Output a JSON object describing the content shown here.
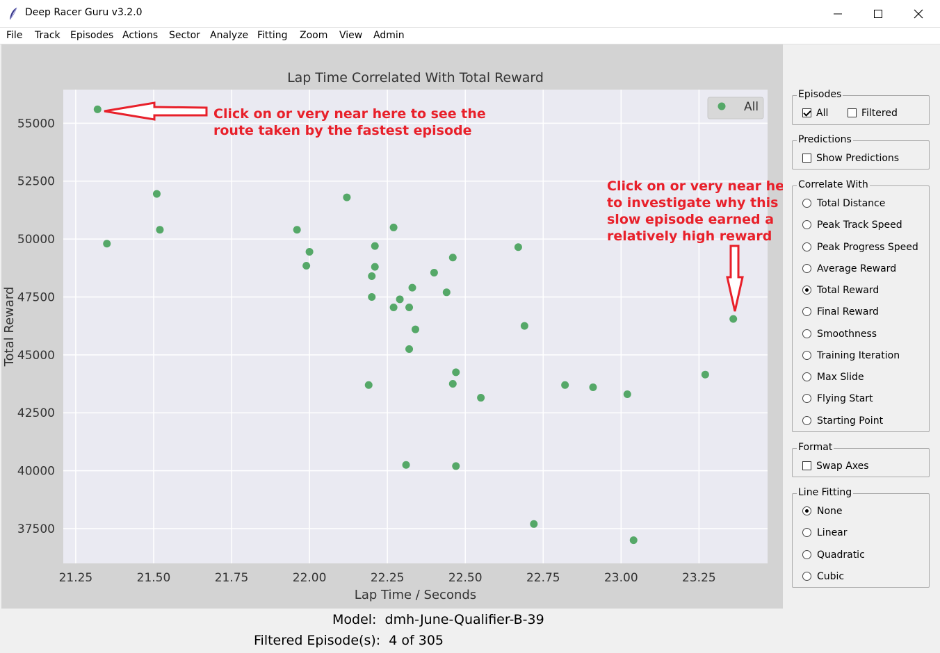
{
  "window": {
    "title": "Deep Racer Guru v3.2.0"
  },
  "menu": [
    "File",
    "Track",
    "Episodes",
    "Actions",
    "Sector",
    "Analyze",
    "Fitting",
    "Zoom",
    "View",
    "Admin"
  ],
  "status": {
    "model_label": "Model:",
    "model_value": "dmh-June-Qualifier-B-39",
    "filtered_label": "Filtered Episode(s):",
    "filtered_value": "4 of 305"
  },
  "panel": {
    "episodes": {
      "legend": "Episodes",
      "options": [
        {
          "label": "All",
          "checked": true
        },
        {
          "label": "Filtered",
          "checked": false
        }
      ]
    },
    "predictions": {
      "legend": "Predictions",
      "options": [
        {
          "label": "Show Predictions",
          "checked": false
        }
      ]
    },
    "correlate": {
      "legend": "Correlate With",
      "options": [
        {
          "label": "Total Distance",
          "checked": false
        },
        {
          "label": "Peak Track Speed",
          "checked": false
        },
        {
          "label": "Peak Progress Speed",
          "checked": false
        },
        {
          "label": "Average Reward",
          "checked": false
        },
        {
          "label": "Total Reward",
          "checked": true
        },
        {
          "label": "Final Reward",
          "checked": false
        },
        {
          "label": "Smoothness",
          "checked": false
        },
        {
          "label": "Training Iteration",
          "checked": false
        },
        {
          "label": "Max Slide",
          "checked": false
        },
        {
          "label": "Flying Start",
          "checked": false
        },
        {
          "label": "Starting Point",
          "checked": false
        }
      ]
    },
    "format": {
      "legend": "Format",
      "options": [
        {
          "label": "Swap Axes",
          "checked": false
        }
      ]
    },
    "line_fitting": {
      "legend": "Line Fitting",
      "options": [
        {
          "label": "None",
          "checked": true
        },
        {
          "label": "Linear",
          "checked": false
        },
        {
          "label": "Quadratic",
          "checked": false
        },
        {
          "label": "Cubic",
          "checked": false
        }
      ]
    }
  },
  "annotations": {
    "fastest": [
      "Click on or very near here to see the",
      "route taken by the fastest episode"
    ],
    "slow": [
      "Click on or very near here",
      "to investigate why this",
      "slow episode earned a",
      "relatively high reward"
    ],
    "color": "#e8202a"
  },
  "chart_data": {
    "type": "scatter",
    "title": "Lap Time Correlated With Total Reward",
    "xlabel": "Lap Time / Seconds",
    "ylabel": "Total Reward",
    "xlim": [
      21.21,
      23.47
    ],
    "ylim": [
      36000,
      56450
    ],
    "xticks": [
      "21.25",
      "21.50",
      "21.75",
      "22.00",
      "22.25",
      "22.50",
      "22.75",
      "23.00",
      "23.25"
    ],
    "yticks": [
      "37500",
      "40000",
      "42500",
      "45000",
      "47500",
      "50000",
      "52500",
      "55000"
    ],
    "grid": true,
    "legend": {
      "label": "All",
      "placement": "top-right"
    },
    "marker_color": "#55a868",
    "plot_bg": "#eaeaf2",
    "series": [
      {
        "name": "All",
        "points": [
          [
            21.32,
            55600
          ],
          [
            21.35,
            49800
          ],
          [
            21.51,
            51950
          ],
          [
            21.52,
            50400
          ],
          [
            21.96,
            50400
          ],
          [
            21.99,
            48850
          ],
          [
            22.0,
            49450
          ],
          [
            22.12,
            51800
          ],
          [
            22.19,
            43700
          ],
          [
            22.2,
            47500
          ],
          [
            22.2,
            48400
          ],
          [
            22.21,
            48800
          ],
          [
            22.21,
            49700
          ],
          [
            22.27,
            47050
          ],
          [
            22.27,
            50500
          ],
          [
            22.29,
            47400
          ],
          [
            22.31,
            40250
          ],
          [
            22.32,
            45250
          ],
          [
            22.32,
            47050
          ],
          [
            22.33,
            47900
          ],
          [
            22.34,
            46100
          ],
          [
            22.4,
            48550
          ],
          [
            22.44,
            47700
          ],
          [
            22.46,
            49200
          ],
          [
            22.46,
            43750
          ],
          [
            22.47,
            44250
          ],
          [
            22.47,
            40200
          ],
          [
            22.55,
            43150
          ],
          [
            22.67,
            49650
          ],
          [
            22.69,
            46250
          ],
          [
            22.72,
            37700
          ],
          [
            22.82,
            43700
          ],
          [
            22.91,
            43600
          ],
          [
            23.02,
            43300
          ],
          [
            23.04,
            37000
          ],
          [
            23.27,
            44150
          ],
          [
            23.36,
            46550
          ]
        ]
      }
    ]
  }
}
